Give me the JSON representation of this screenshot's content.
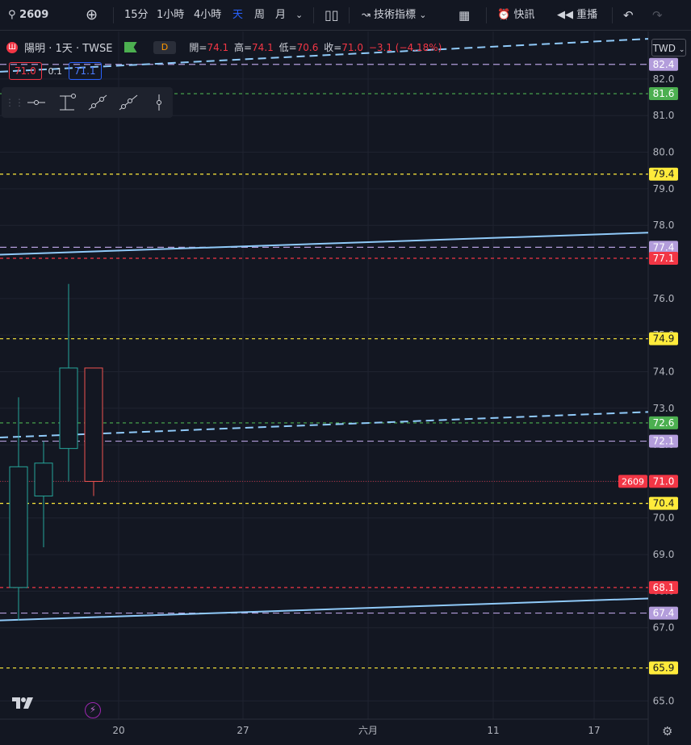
{
  "toolbar": {
    "symbol": "2609",
    "intervals": [
      "15分",
      "1小時",
      "4小時",
      "天",
      "周",
      "月"
    ],
    "active_interval": "天",
    "indicators_label": "技術指標",
    "alert_label": "快訊",
    "replay_label": "重播",
    "icons": [
      "search-icon",
      "add-icon",
      "chevron-down-icon",
      "candles-icon",
      "indicators-icon",
      "layout-icon",
      "alarm-icon",
      "replay-icon",
      "undo-icon",
      "redo-icon"
    ]
  },
  "legend": {
    "title": "陽明 · 1天 · TWSE",
    "badge": "D",
    "open_label": "開=",
    "open": "74.1",
    "high_label": "高=",
    "high": "74.1",
    "low_label": "低=",
    "low": "70.6",
    "close_label": "收=",
    "close": "71.0",
    "change": "−3.1 (−4.18%)",
    "sell_price": "71.0",
    "spread": "0.1",
    "buy_price": "71.1"
  },
  "currency": "TWD",
  "colors": {
    "background": "#131722",
    "up": "#26a69a",
    "down": "#ef5350",
    "purple": "#b39ddb",
    "yellow": "#ffeb3b",
    "green": "#4caf50",
    "red": "#f23645",
    "trend": "#90caf9"
  },
  "chart_data": {
    "type": "candlestick",
    "symbol": "2609",
    "y_ticks": [
      "65.0",
      "67.0",
      "68.0",
      "69.0",
      "70.0",
      "71.0",
      "72.0",
      "73.0",
      "74.0",
      "75.0",
      "76.0",
      "78.0",
      "79.0",
      "80.0",
      "81.0",
      "82.0"
    ],
    "ylim": [
      64.5,
      83.3
    ],
    "x_ticks": [
      "20",
      "27",
      "六月",
      "11",
      "17"
    ],
    "candles": [
      {
        "open": 68.1,
        "high": 73.3,
        "low": 67.2,
        "close": 71.4
      },
      {
        "open": 70.6,
        "high": 72.1,
        "low": 69.2,
        "close": 71.5
      },
      {
        "open": 71.9,
        "high": 76.4,
        "low": 71.0,
        "close": 74.1
      },
      {
        "open": 74.1,
        "high": 74.1,
        "low": 70.6,
        "close": 71.0
      }
    ],
    "levels": [
      {
        "value": 82.4,
        "color": "#b39ddb",
        "label": "82.4"
      },
      {
        "value": 81.6,
        "color": "#4caf50",
        "label": "81.6"
      },
      {
        "value": 79.4,
        "color": "#ffeb3b",
        "label": "79.4"
      },
      {
        "value": 77.4,
        "color": "#b39ddb",
        "label": "77.4"
      },
      {
        "value": 77.1,
        "color": "#f23645",
        "label": "77.1"
      },
      {
        "value": 74.9,
        "color": "#ffeb3b",
        "label": "74.9"
      },
      {
        "value": 72.6,
        "color": "#4caf50",
        "label": "72.6"
      },
      {
        "value": 72.1,
        "color": "#b39ddb",
        "label": "72.1"
      },
      {
        "value": 70.4,
        "color": "#ffeb3b",
        "label": "70.4"
      },
      {
        "value": 68.1,
        "color": "#f23645",
        "label": "68.1"
      },
      {
        "value": 67.4,
        "color": "#b39ddb",
        "label": "67.4"
      },
      {
        "value": 65.9,
        "color": "#ffeb3b",
        "label": "65.9"
      }
    ],
    "last_price": {
      "value": 71.0,
      "label": "71.0",
      "symbol_tag": "2609"
    },
    "trendlines": [
      {
        "from": 77.2,
        "to": 77.8,
        "style": "solid"
      },
      {
        "from": 67.2,
        "to": 67.8,
        "style": "solid"
      },
      {
        "from": 72.2,
        "to": 72.9,
        "style": "dashed"
      },
      {
        "from": 82.2,
        "to": 83.1,
        "style": "dashed"
      }
    ]
  }
}
